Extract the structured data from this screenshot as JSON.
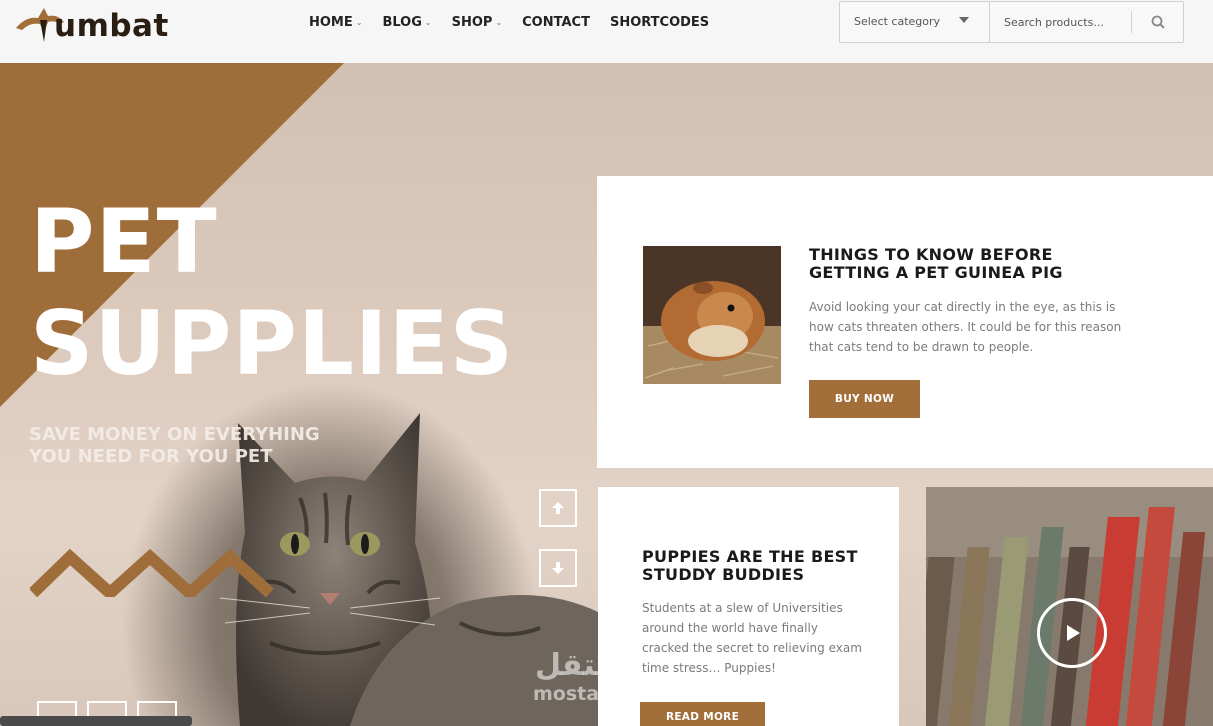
{
  "header": {
    "logo_text": "umbat",
    "nav": [
      {
        "label": "HOME",
        "has_caret": true
      },
      {
        "label": "BLOG",
        "has_caret": true
      },
      {
        "label": "SHOP",
        "has_caret": true
      },
      {
        "label": "CONTACT",
        "has_caret": false
      },
      {
        "label": "SHORTCODES",
        "has_caret": false
      }
    ],
    "category_select": "Select category",
    "search_placeholder": "Search products...",
    "search_icon": "search-icon"
  },
  "hero": {
    "title_line1": "PET",
    "title_line2": "SUPPLIES",
    "subtitle_line1": "SAVE MONEY ON EVERYHING",
    "subtitle_line2": "YOU NEED FOR YOU PET",
    "up_icon": "arrow-up-icon",
    "down_icon": "arrow-down-icon",
    "social_icons": [
      "facebook-icon",
      "twitter-icon",
      "pinterest-icon"
    ]
  },
  "card1": {
    "title_line1": "THINGS TO KNOW BEFORE",
    "title_line2": "GETTING A PET GUINEA PIG",
    "body_lines": [
      "Avoid looking your cat directly in the eye, as this is",
      "how cats threaten others. It could be for this reason",
      "that cats tend to be drawn to people."
    ],
    "button": "BUY NOW"
  },
  "card2": {
    "title_line1": "PUPPIES ARE THE BEST",
    "title_line2": "STUDDY BUDDIES",
    "body_lines": [
      "Students at a slew of Universities",
      "around the world have finally",
      "cracked the secret to relieving exam",
      "time stress… Puppies!"
    ],
    "button": "READ MORE"
  },
  "video": {
    "play_icon": "play-icon"
  },
  "watermark": {
    "arabic": "مستقل",
    "latin": "mostaql.com"
  },
  "colors": {
    "accent": "#a26f3b",
    "text_dark": "#1a1a1a",
    "text_muted": "#7b7b7b"
  }
}
